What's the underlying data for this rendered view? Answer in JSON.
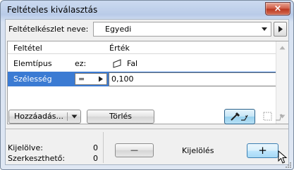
{
  "window": {
    "title": "Feltételes kiválasztás",
    "close_label": "×"
  },
  "criteria_set": {
    "label": "Feltételkészlet neve:",
    "value": "Egyedi"
  },
  "table": {
    "headers": {
      "condition": "Feltétel",
      "value": "Érték"
    },
    "rows": [
      {
        "condition": "Elemtípus",
        "operator": "ez:",
        "value": "Fal",
        "icon": "wall-icon"
      },
      {
        "condition": "Szélesség",
        "operator": "=",
        "value": "0,100",
        "selected": true
      }
    ]
  },
  "buttons": {
    "add": "Hozzáadás...",
    "delete": "Törlés",
    "minus": "—",
    "plus": "+"
  },
  "status": {
    "selected_label": "Kijelölve:",
    "selected_value": "0",
    "editable_label": "Szerkeszthető:",
    "editable_value": "0",
    "selection_label": "Kijelölés"
  },
  "colors": {
    "selection": "#3b7bd3",
    "title_bar": "#b9cbe8",
    "close": "#c94c36"
  }
}
